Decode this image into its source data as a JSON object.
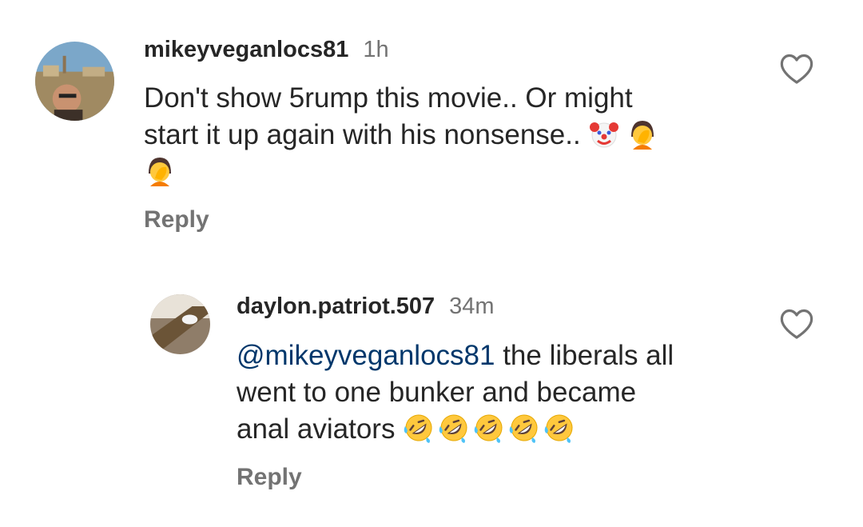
{
  "comments": [
    {
      "username": "mikeyveganlocs81",
      "time": "1h",
      "text_line1": "Don't show 5rump this movie.. Or might",
      "text_line2": "start it up again with his nonsense..",
      "emojis": [
        "clown-face",
        "person-facepalming",
        "person-facepalming"
      ],
      "reply_label": "Reply"
    },
    {
      "username": "daylon.patriot.507",
      "time": "34m",
      "mention": "@mikeyveganlocs81",
      "text_after_mention": " the liberals all",
      "text_line2": "went to one bunker and became",
      "text_line3": "anal aviators",
      "emojis": [
        "rolling-on-floor-laughing",
        "rolling-on-floor-laughing",
        "rolling-on-floor-laughing",
        "rolling-on-floor-laughing",
        "rolling-on-floor-laughing"
      ],
      "reply_label": "Reply"
    }
  ],
  "icons": {
    "like": "heart-outline-icon"
  },
  "colors": {
    "text": "#262626",
    "secondary": "#737373",
    "mention": "#00376b"
  }
}
